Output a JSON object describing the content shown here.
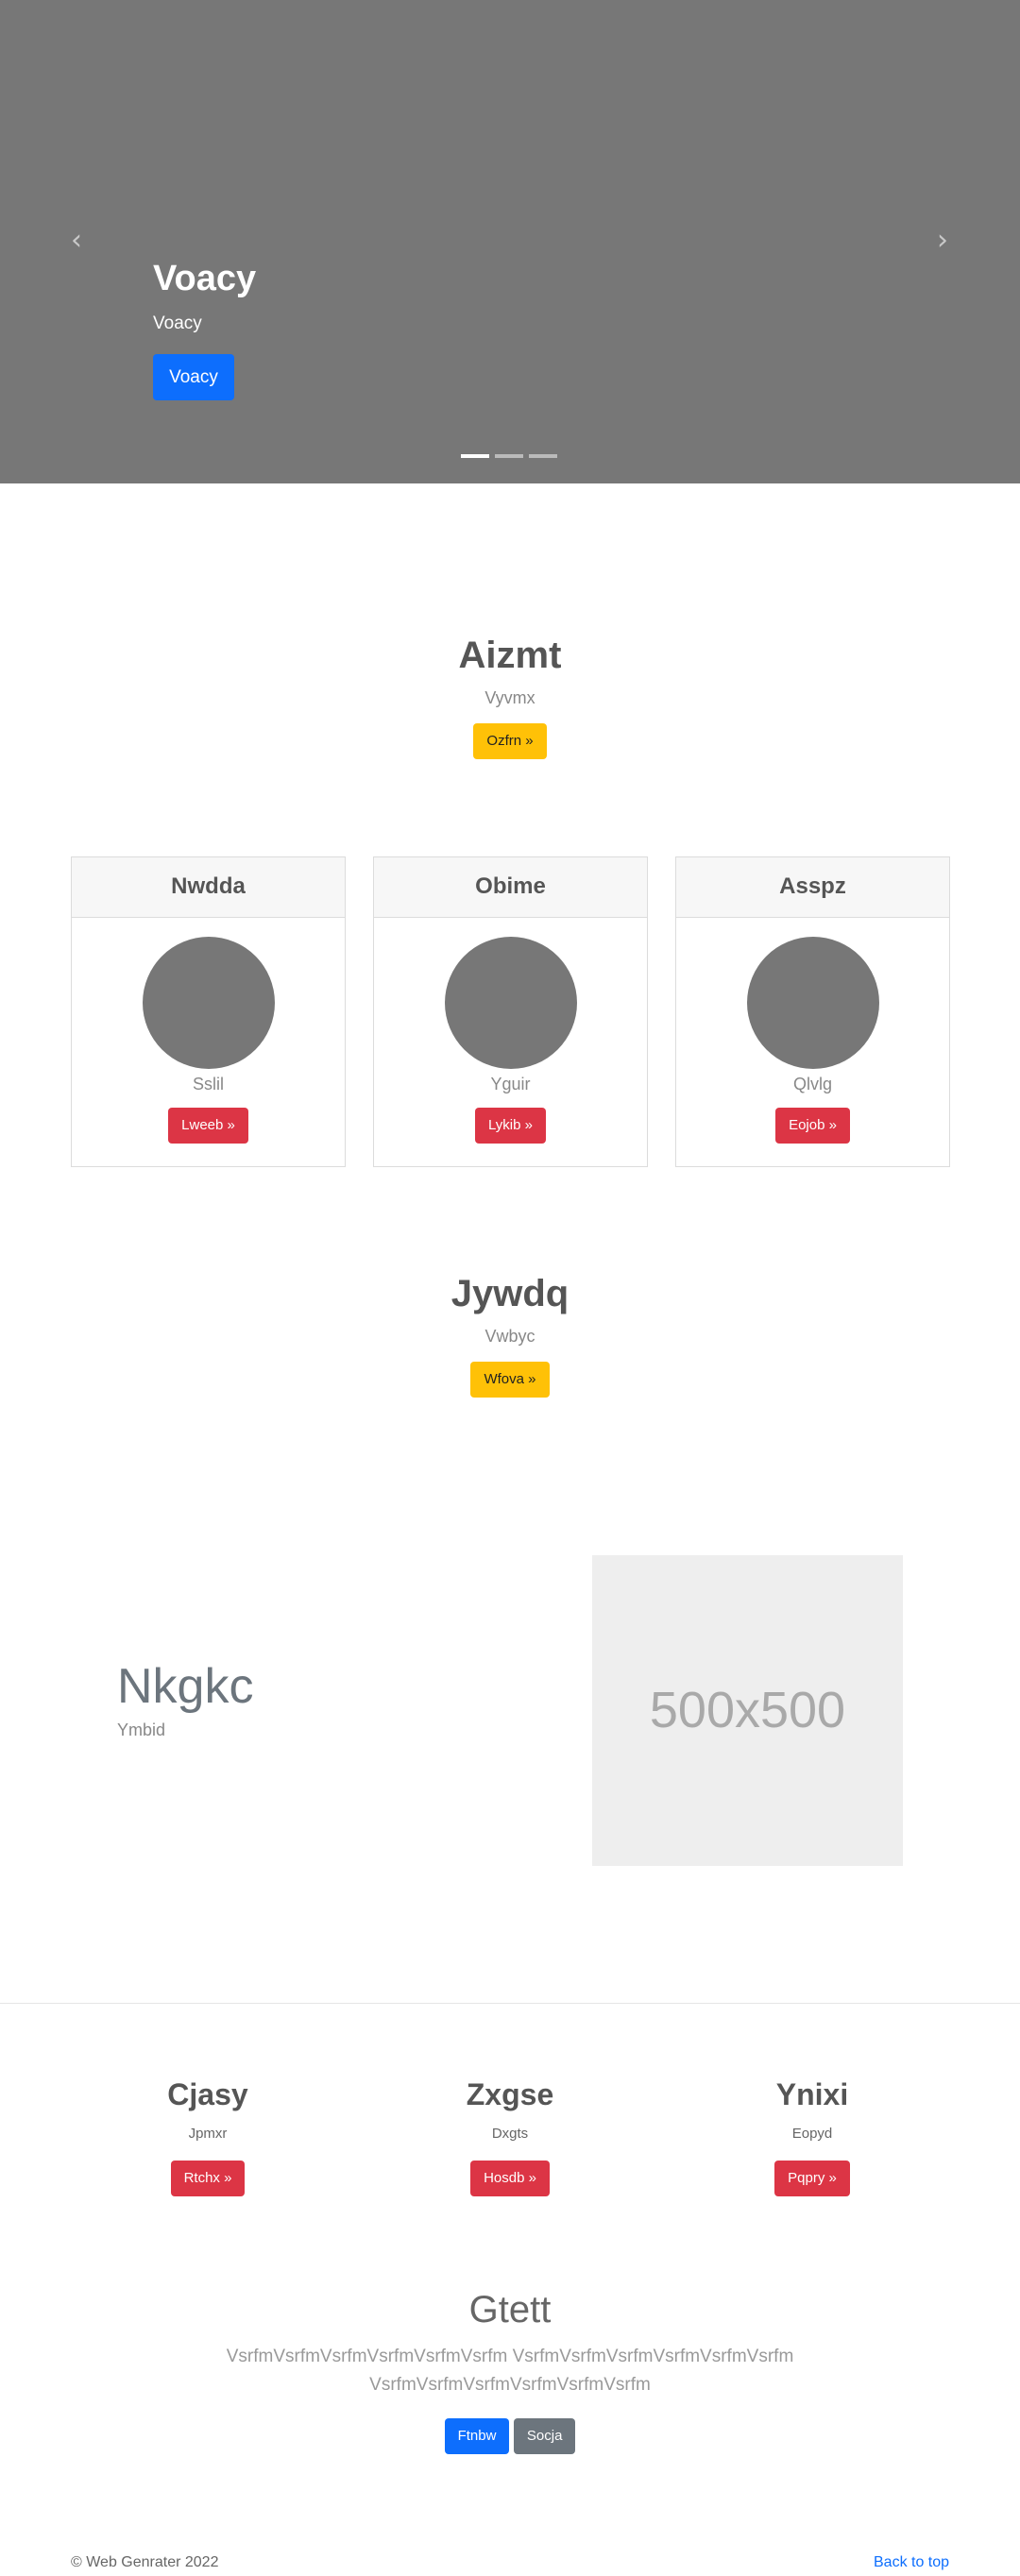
{
  "hero": {
    "title": "Voacy",
    "subtitle": "Voacy",
    "button_label": "Voacy",
    "prev_icon": "‹",
    "next_icon": "›"
  },
  "intro": {
    "title": "Aizmt",
    "subtitle": "Vyvmx",
    "button_label": "Ozfrn »"
  },
  "cards": [
    {
      "header": "Nwdda",
      "text": "Sslil",
      "button_label": "Lweeb »"
    },
    {
      "header": "Obime",
      "text": "Yguir",
      "button_label": "Lykib »"
    },
    {
      "header": "Asspz",
      "text": "Qlvlg",
      "button_label": "Eojob »"
    }
  ],
  "section2": {
    "title": "Jywdq",
    "subtitle": "Vwbyc",
    "button_label": "Wfova »"
  },
  "feature": {
    "title": "Nkgkc",
    "subtitle": "Ymbid",
    "placeholder_text": "500x500"
  },
  "columns": [
    {
      "title": "Cjasy",
      "subtitle": "Jpmxr",
      "button_label": "Rtchx »"
    },
    {
      "title": "Zxgse",
      "subtitle": "Dxgts",
      "button_label": "Hosdb »"
    },
    {
      "title": "Ynixi",
      "subtitle": "Eopyd",
      "button_label": "Pqpry »"
    }
  ],
  "gtett": {
    "title": "Gtett",
    "text": "VsrfmVsrfmVsrfmVsrfmVsrfmVsrfm VsrfmVsrfmVsrfmVsrfmVsrfmVsrfm VsrfmVsrfmVsrfmVsrfmVsrfmVsrfm",
    "primary_label": "Ftnbw",
    "secondary_label": "Socja"
  },
  "footer": {
    "copyright": "© Web Genrater 2022",
    "back_to_top": "Back to top"
  },
  "colors": {
    "primary": "#0d6efd",
    "warning": "#ffc107",
    "danger": "#dc3545",
    "secondary": "#6c757d",
    "hero_bg": "#777777"
  }
}
